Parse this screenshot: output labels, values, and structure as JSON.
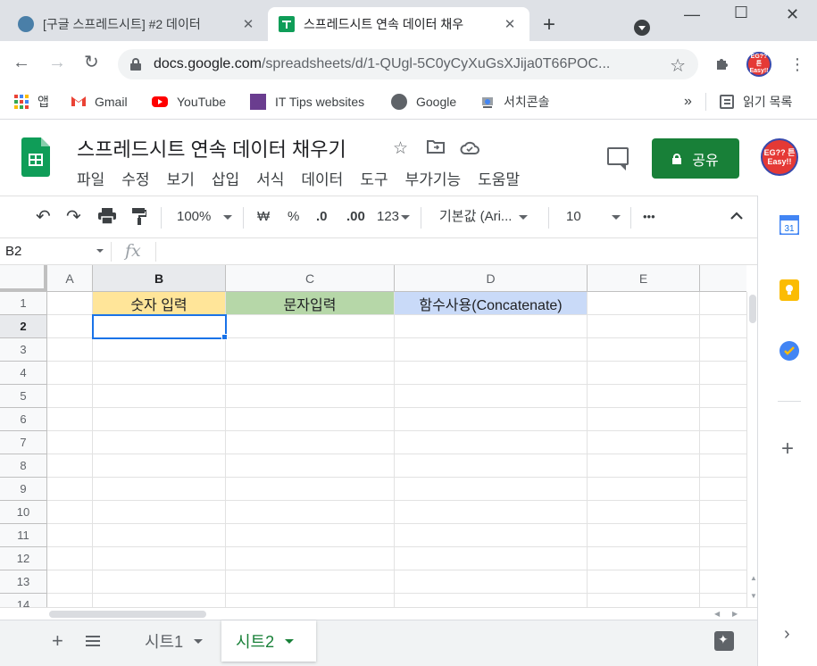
{
  "browser": {
    "tabs": [
      {
        "title": "[구글 스프레드시트] #2 데이터",
        "active": false
      },
      {
        "title": "스프레드시트 연속 데이터 채우",
        "active": true
      }
    ],
    "url_host": "docs.google.com",
    "url_path": "/spreadsheets/d/1-QUgl-5C0yCyXuGsXJija0T66POC...",
    "profile_text": "EG?? 튼 Easy!!"
  },
  "bookmarks": [
    {
      "label": "앱",
      "icon": "apps-grid-icon"
    },
    {
      "label": "Gmail",
      "icon": "gmail-icon"
    },
    {
      "label": "YouTube",
      "icon": "youtube-icon"
    },
    {
      "label": "IT Tips websites",
      "icon": "folder-icon"
    },
    {
      "label": "Google",
      "icon": "globe-icon"
    },
    {
      "label": "서치콘솔",
      "icon": "search-console-icon"
    }
  ],
  "bookmarks_more": "»",
  "reading_list": "읽기 목록",
  "doc": {
    "title": "스프레드시트 연속 데이터 채우기",
    "menus": [
      "파일",
      "수정",
      "보기",
      "삽입",
      "서식",
      "데이터",
      "도구",
      "부가기능",
      "도움말"
    ],
    "share_label": "공유"
  },
  "format_toolbar": {
    "zoom": "100%",
    "currency": "₩",
    "percent": "%",
    "decrease_decimal": ".0",
    "increase_decimal": ".00",
    "number_format": "123",
    "font": "기본값 (Ari...",
    "font_size": "10",
    "more": "•••"
  },
  "formula_bar": {
    "cell_ref": "B2",
    "fx_label": "fx",
    "content": ""
  },
  "grid": {
    "columns": [
      "A",
      "B",
      "C",
      "D",
      "E"
    ],
    "selected_column": "B",
    "rows": [
      "1",
      "2",
      "3",
      "4",
      "5",
      "6",
      "7",
      "8",
      "9",
      "10",
      "11",
      "12",
      "13",
      "14"
    ],
    "selected_row": "2",
    "header_cells": [
      {
        "ref": "B1",
        "text": "숫자 입력",
        "bg": "#ffe599"
      },
      {
        "ref": "C1",
        "text": "문자입력",
        "bg": "#b6d7a8"
      },
      {
        "ref": "D1",
        "text": "함수사용(Concatenate)",
        "bg": "#c9daf8"
      }
    ],
    "selected_cell": "B2"
  },
  "sheets": [
    {
      "name": "시트1",
      "active": false
    },
    {
      "name": "시트2",
      "active": true
    }
  ],
  "colors": {
    "sheets_green": "#188038",
    "selection_blue": "#1a73e8"
  }
}
